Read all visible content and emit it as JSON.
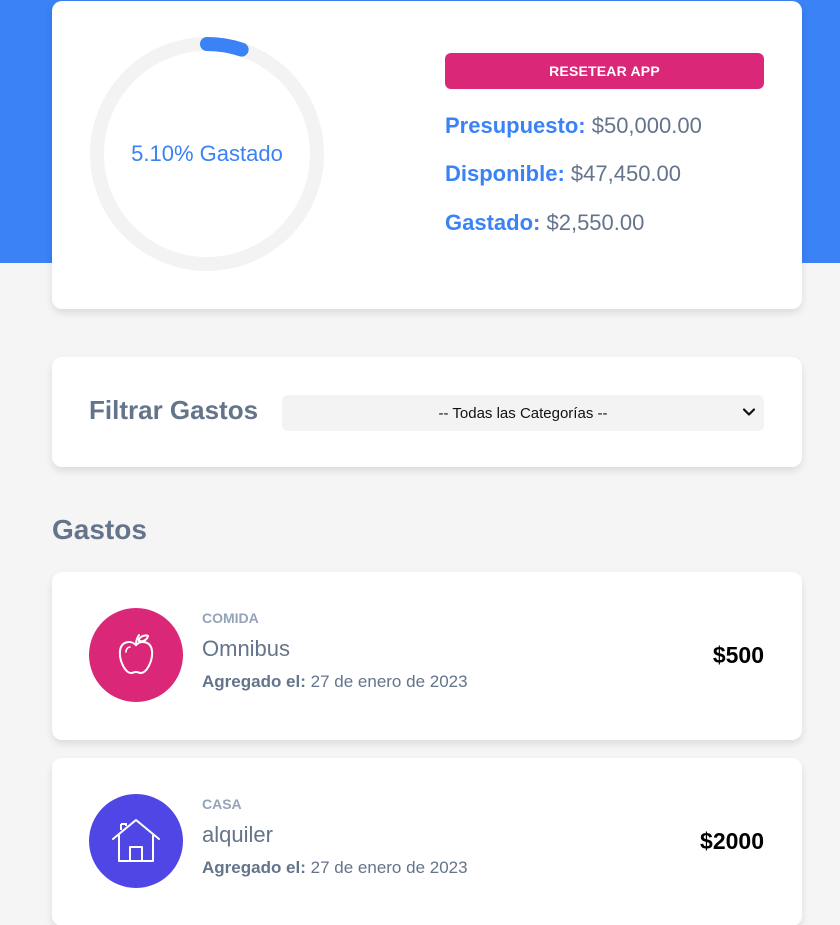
{
  "colors": {
    "accent": "#3b82f6",
    "reset_button": "#db2777",
    "category_comida": "#db2777",
    "category_casa": "#4f46e5",
    "track": "#f3f3f3"
  },
  "budget": {
    "spent_fraction": 0.051,
    "progress_text": "5.10% Gastado",
    "reset_label": "RESETEAR APP",
    "presupuesto_label": "Presupuesto:",
    "presupuesto_value": "$50,000.00",
    "disponible_label": "Disponible:",
    "disponible_value": "$47,450.00",
    "gastado_label": "Gastado:",
    "gastado_value": "$2,550.00"
  },
  "filter": {
    "label": "Filtrar Gastos",
    "selected": "-- Todas las Categorías --"
  },
  "expenses": {
    "title": "Gastos",
    "items": [
      {
        "category": "COMIDA",
        "name": "Omnibus",
        "date_label": "Agregado el:",
        "date": "27 de enero de 2023",
        "amount": "$500",
        "icon": "apple-icon"
      },
      {
        "category": "CASA",
        "name": "alquiler",
        "date_label": "Agregado el:",
        "date": "27 de enero de 2023",
        "amount": "$2000",
        "icon": "house-icon"
      }
    ]
  }
}
